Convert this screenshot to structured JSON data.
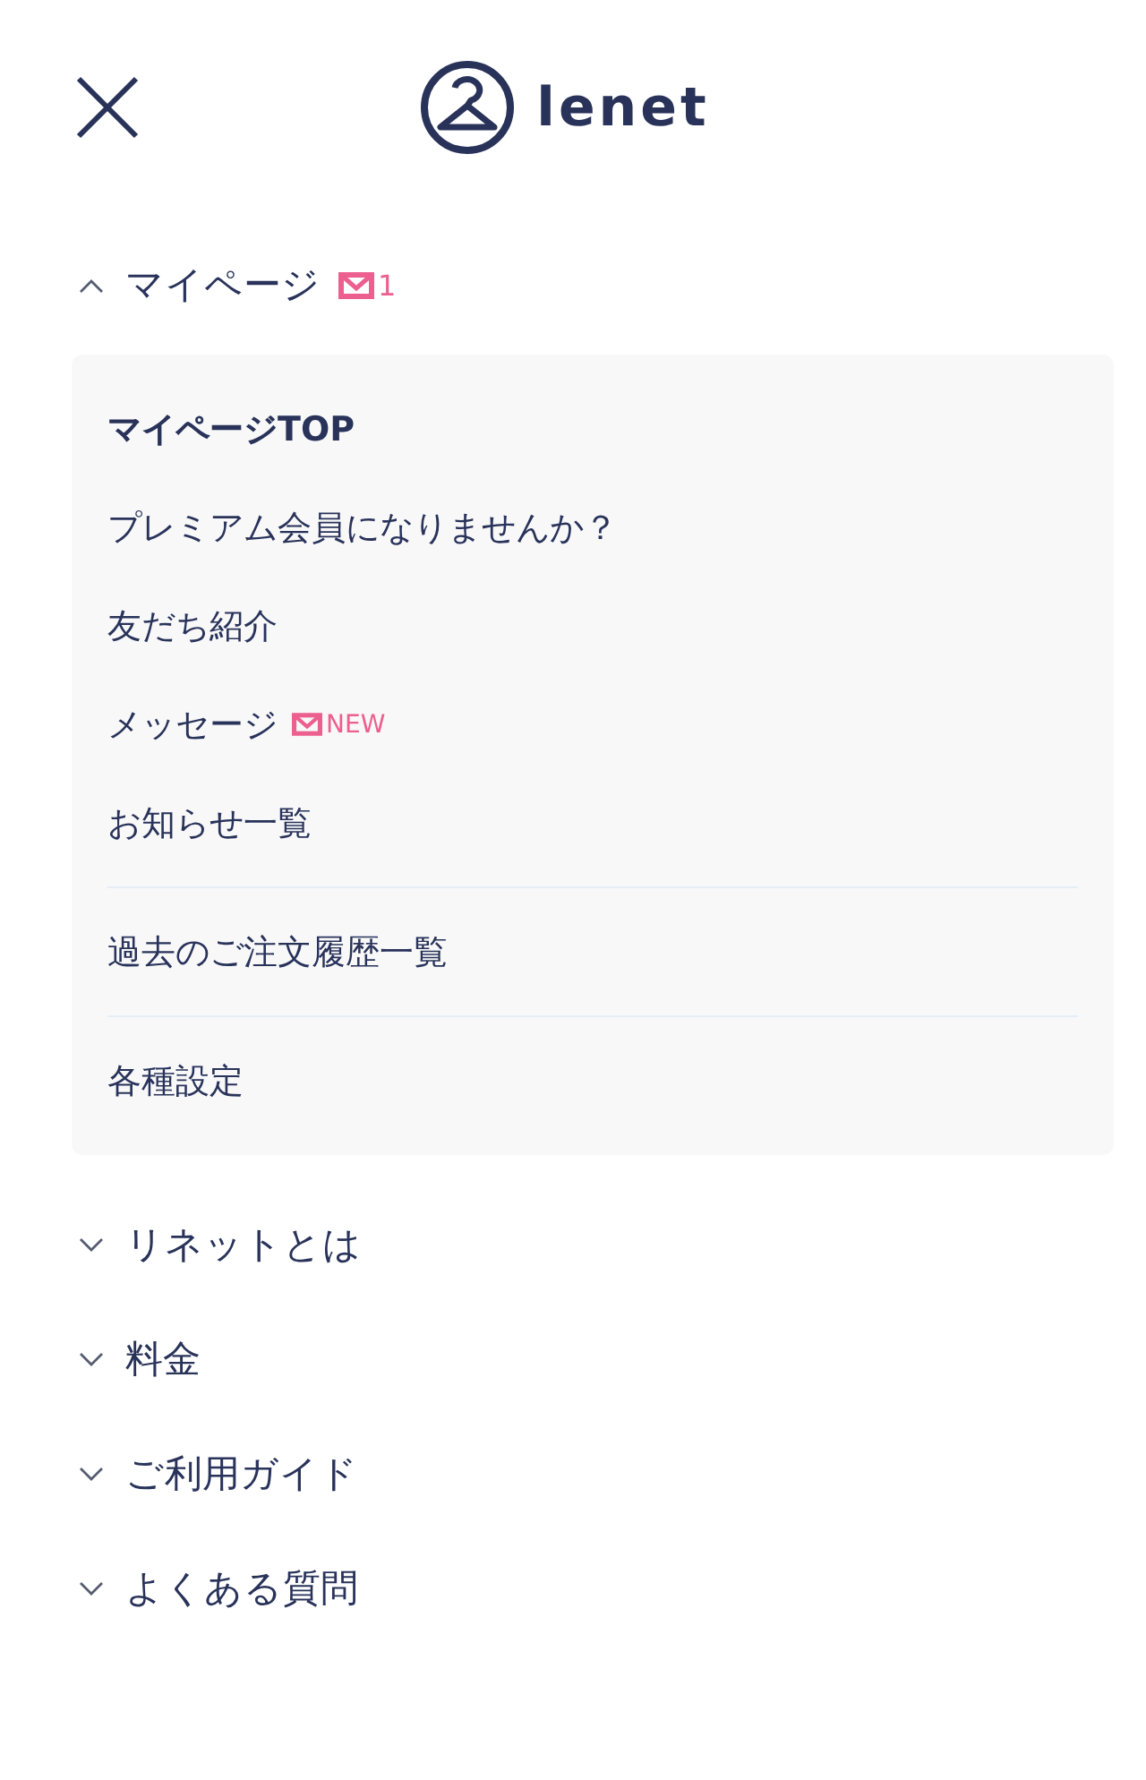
{
  "header": {
    "logo": "lenet"
  },
  "sections": [
    {
      "label": "マイページ",
      "expanded": true,
      "badge": "1",
      "groups": [
        [
          {
            "label": "マイページTOP",
            "kind": "top"
          },
          {
            "label": "プレミアム会員になりませんか？",
            "kind": "link"
          },
          {
            "label": "友だち紹介",
            "kind": "link"
          },
          {
            "label": "メッセージ",
            "kind": "link",
            "badge": "NEW"
          },
          {
            "label": "お知らせ一覧",
            "kind": "link"
          }
        ],
        [
          {
            "label": "過去のご注文履歴一覧",
            "kind": "link"
          }
        ],
        [
          {
            "label": "各種設定",
            "kind": "link"
          }
        ]
      ]
    },
    {
      "label": "リネットとは",
      "expanded": false
    },
    {
      "label": "料金",
      "expanded": false
    },
    {
      "label": "ご利用ガイド",
      "expanded": false
    },
    {
      "label": "よくある質問",
      "expanded": false
    }
  ]
}
